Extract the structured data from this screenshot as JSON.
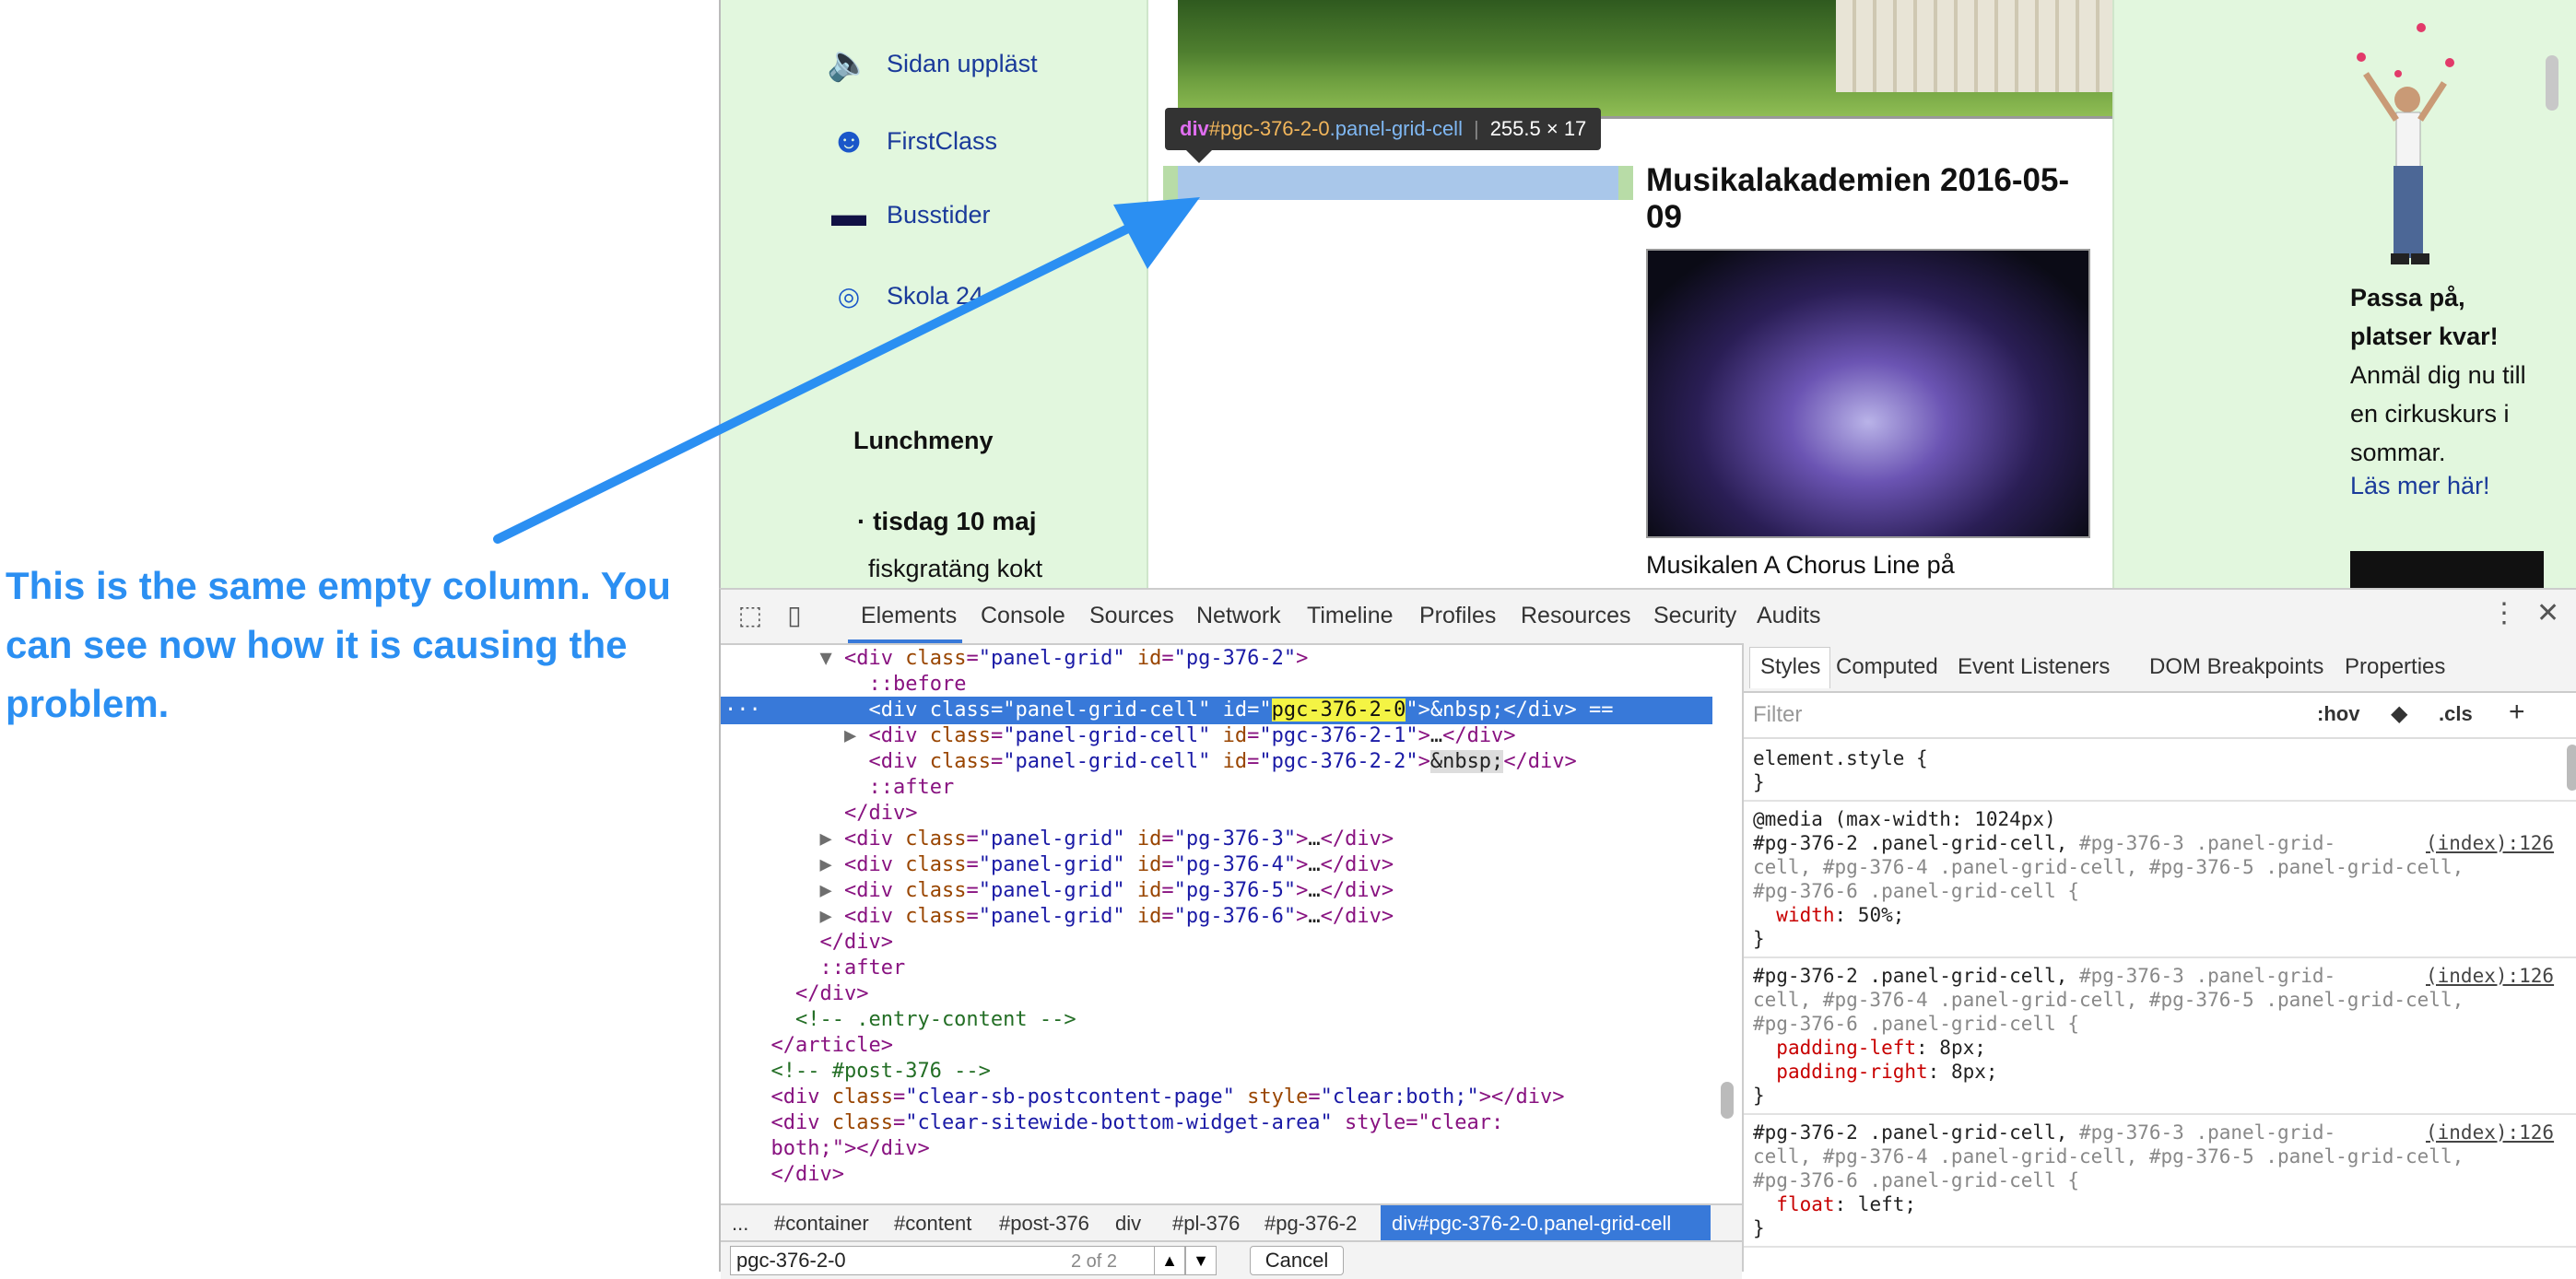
{
  "page": {
    "sidebar": {
      "items": [
        {
          "label": "Sidan uppläst",
          "icon": "speaker-icon"
        },
        {
          "label": "FirstClass",
          "icon": "people-icon"
        },
        {
          "label": "Busstider",
          "icon": "bus-icon"
        },
        {
          "label": "Skola 24",
          "icon": "school24-icon"
        }
      ],
      "lunch_title": "Lunchmeny",
      "lunch_day": "· tisdag 10 maj",
      "lunch_food": "fiskgratäng kokt"
    },
    "tooltip": {
      "tag": "div",
      "id": "#pgc-376-2-0",
      "class": ".panel-grid-cell",
      "size": "255.5 × 17"
    },
    "article": {
      "title": "Musikalakademien 2016-05-09",
      "text": "Musikalen A Chorus Line på"
    },
    "right": {
      "bold": "Passa på, platser kvar!",
      "text": "Anmäl dig nu till en cirkuskurs i sommar.",
      "link": "Läs mer här!"
    }
  },
  "annotation": "This is the same empty column. You can see now how it is causing the problem.",
  "colors": {
    "annotation": "#2b8ff2",
    "selection": "#3879d9",
    "sidebar_bg": "#e2f7de"
  },
  "devtools": {
    "tabs": [
      "Elements",
      "Console",
      "Sources",
      "Network",
      "Timeline",
      "Profiles",
      "Resources",
      "Security",
      "Audits"
    ],
    "active_tab": "Elements",
    "dom_lines": [
      {
        "indent": 8,
        "tri": "▼",
        "html": "<div class=\"panel-grid\" id=\"pg-376-2\">"
      },
      {
        "indent": 10,
        "tri": "",
        "html": "::before"
      },
      {
        "indent": 10,
        "tri": "",
        "html": "<div class=\"panel-grid-cell\" id=\"pgc-376-2-0\">&nbsp;</div> =="
      },
      {
        "indent": 10,
        "tri": "▶",
        "html": "<div class=\"panel-grid-cell\" id=\"pgc-376-2-1\">…</div>"
      },
      {
        "indent": 10,
        "tri": "",
        "html": "<div class=\"panel-grid-cell\" id=\"pgc-376-2-2\">&nbsp;</div>"
      },
      {
        "indent": 10,
        "tri": "",
        "html": "::after"
      },
      {
        "indent": 8,
        "tri": "",
        "html": "</div>"
      },
      {
        "indent": 8,
        "tri": "▶",
        "html": "<div class=\"panel-grid\" id=\"pg-376-3\">…</div>"
      },
      {
        "indent": 8,
        "tri": "▶",
        "html": "<div class=\"panel-grid\" id=\"pg-376-4\">…</div>"
      },
      {
        "indent": 8,
        "tri": "▶",
        "html": "<div class=\"panel-grid\" id=\"pg-376-5\">…</div>"
      },
      {
        "indent": 8,
        "tri": "▶",
        "html": "<div class=\"panel-grid\" id=\"pg-376-6\">…</div>"
      },
      {
        "indent": 6,
        "tri": "",
        "html": "</div>"
      },
      {
        "indent": 6,
        "tri": "",
        "html": "::after"
      },
      {
        "indent": 4,
        "tri": "",
        "html": "</div>"
      },
      {
        "indent": 4,
        "tri": "",
        "html": "<!-- .entry-content -->"
      },
      {
        "indent": 2,
        "tri": "",
        "html": "</article>"
      },
      {
        "indent": 2,
        "tri": "",
        "html": "<!-- #post-376 -->"
      },
      {
        "indent": 2,
        "tri": "",
        "html": "<div class=\"clear-sb-postcontent-page\" style=\"clear:both;\"></div>"
      },
      {
        "indent": 2,
        "tri": "",
        "html": "<div class=\"clear-sitewide-bottom-widget-area\" style=\"clear:"
      },
      {
        "indent": 2,
        "tri": "",
        "html": "both;\"></div>"
      },
      {
        "indent": 2,
        "tri": "",
        "html": "</div>"
      }
    ],
    "breadcrumbs": [
      "...",
      "#container",
      "#content",
      "#post-376",
      "div",
      "#pl-376",
      "#pg-376-2"
    ],
    "breadcrumb_selected": "div#pgc-376-2-0.panel-grid-cell",
    "search": {
      "value": "pgc-376-2-0",
      "count": "2 of 2",
      "cancel": "Cancel"
    },
    "styles": {
      "tabs": [
        "Styles",
        "Computed",
        "Event Listeners",
        "DOM Breakpoints",
        "Properties"
      ],
      "filter_placeholder": "Filter",
      "hov": ":hov",
      "cls": ".cls",
      "plus": "+",
      "element_style": "element.style {",
      "media": "@media (max-width: 1024px)",
      "selector_main": "#pg-376-2 .panel-grid-cell,",
      "selector_rest1": " #pg-376-3 .panel-grid-",
      "selector_rest2": "cell, #pg-376-4 .panel-grid-cell, #pg-376-5 .panel-grid-cell,",
      "selector_rest3": "#pg-376-6 .panel-grid-cell {",
      "source": "(index):126",
      "rules": [
        {
          "props": [
            [
              "width",
              "50%;"
            ]
          ]
        },
        {
          "props": [
            [
              "padding-left",
              "8px;"
            ],
            [
              "padding-right",
              "8px;"
            ]
          ]
        },
        {
          "props": [
            [
              "float",
              "left;"
            ]
          ]
        }
      ],
      "close": "}"
    }
  }
}
